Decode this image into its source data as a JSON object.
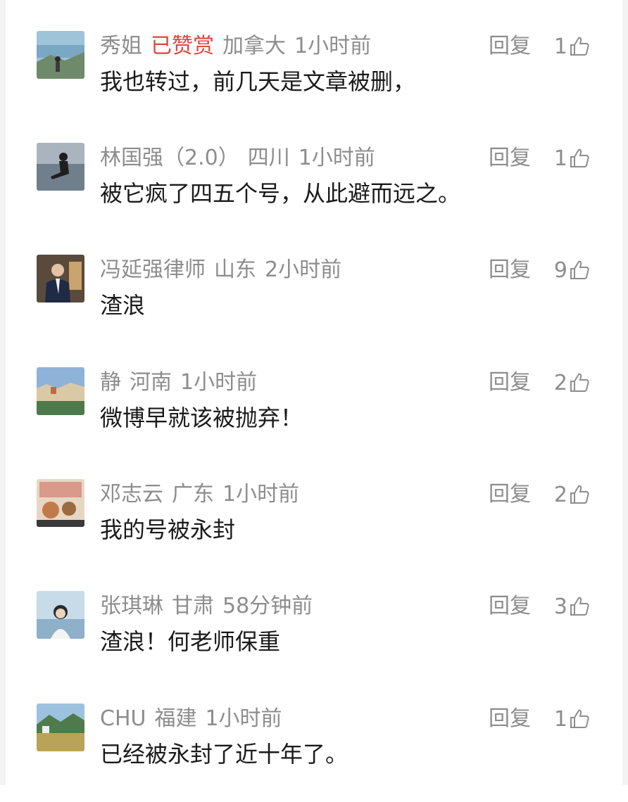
{
  "reply_label": "回复",
  "comments": [
    {
      "name": "秀姐",
      "praised": "已赞赏",
      "location": "加拿大",
      "time": "1小时前",
      "text": "我也转过，前几天是文章被删，",
      "likes": "1",
      "avatar": "lake-landscape"
    },
    {
      "name": "林国强（2.0）",
      "praised": "",
      "location": "四川",
      "time": "1小时前",
      "text": "被它疯了四五个号，从此避而远之。",
      "likes": "1",
      "avatar": "person-sitting-by-water"
    },
    {
      "name": "冯延强律师",
      "praised": "",
      "location": "山东",
      "time": "2小时前",
      "text": "渣浪",
      "likes": "9",
      "avatar": "man-in-suit"
    },
    {
      "name": "静",
      "praised": "",
      "location": "河南",
      "time": "1小时前",
      "text": "微博早就该被抛弃！",
      "likes": "2",
      "avatar": "town-landscape"
    },
    {
      "name": "邓志云",
      "praised": "",
      "location": "广东",
      "time": "1小时前",
      "text": "我的号被永封",
      "likes": "2",
      "avatar": "food-photo"
    },
    {
      "name": "张琪琳",
      "praised": "",
      "location": "甘肃",
      "time": "58分钟前",
      "text": "渣浪！何老师保重",
      "likes": "3",
      "avatar": "woman-portrait"
    },
    {
      "name": "CHU",
      "praised": "",
      "location": "福建",
      "time": "1小时前",
      "text": "已经被永封了近十年了。",
      "likes": "1",
      "avatar": "mountain-field"
    }
  ]
}
